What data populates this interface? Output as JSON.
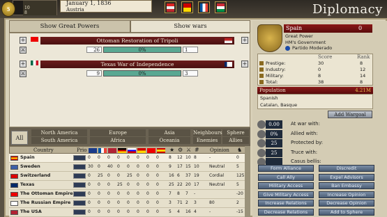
{
  "topbar": {
    "crest_badge": "5",
    "stats": [
      "",
      "10",
      "8"
    ],
    "date": "January 1, 1836",
    "country": "Austria"
  },
  "window": {
    "title": "Diplomacy"
  },
  "tabs": {
    "great_powers": "Show Great Powers",
    "wars": "Show wars"
  },
  "wars": [
    {
      "name": "Ottoman Restoration of Tripoli",
      "left_num": "26",
      "pct": "0%",
      "right_num": "1"
    },
    {
      "name": "Texas War of Independence",
      "left_num": "9",
      "pct": "0%",
      "right_num": "3"
    }
  ],
  "filters": {
    "all": "All",
    "regions": [
      "North America",
      "Europe",
      "Asia",
      "Neighbours",
      "Sphere",
      "South America",
      "Africa",
      "Oceania",
      "Enemies",
      "Allies"
    ]
  },
  "table": {
    "headers": {
      "country": "Country",
      "prio": "Prio",
      "opinion": "Opinion"
    },
    "rows": [
      {
        "name": "Spain",
        "cells": [
          "0",
          "0",
          "0",
          "0",
          "0",
          "0",
          "0",
          "0",
          "8",
          "12",
          "10",
          "8",
          "-",
          "",
          "0"
        ]
      },
      {
        "name": "Sweden",
        "cells": [
          "30",
          "0",
          "40",
          "0",
          "0",
          "0",
          "0",
          "0",
          "9",
          "17",
          "15",
          "10",
          "Neutral",
          "",
          "5"
        ]
      },
      {
        "name": "Switzerland",
        "cells": [
          "0",
          "25",
          "0",
          "0",
          "25",
          "0",
          "0",
          "0",
          "16",
          "6",
          "37",
          "19",
          "Cordial",
          "",
          "125"
        ]
      },
      {
        "name": "Texas",
        "cells": [
          "0",
          "0",
          "0",
          "25",
          "0",
          "0",
          "0",
          "0",
          "25",
          "22",
          "20",
          "17",
          "Neutral",
          "",
          "5"
        ]
      },
      {
        "name": "The Ottoman Empire",
        "cells": [
          "0",
          "0",
          "0",
          "0",
          "0",
          "0",
          "0",
          "0",
          "7",
          "8",
          "7",
          "-",
          "",
          "",
          "-20"
        ]
      },
      {
        "name": "The Russian Empire",
        "cells": [
          "0",
          "0",
          "0",
          "0",
          "0",
          "0",
          "0",
          "0",
          "3",
          "71",
          "2",
          "3",
          "80",
          "",
          "2"
        ]
      },
      {
        "name": "The USA",
        "cells": [
          "0",
          "0",
          "0",
          "0",
          "0",
          "0",
          "0",
          "0",
          "5",
          "4",
          "16",
          "4",
          "-",
          "",
          "-15"
        ]
      }
    ]
  },
  "selected_country": {
    "name": "Spain",
    "count": "0",
    "status": "Great Power",
    "government": "HM's Government",
    "party": "Partido Moderado",
    "score_header": "Score",
    "rank_header": "Rank",
    "scores": [
      {
        "label": "Prestige:",
        "score": "30",
        "rank": "8"
      },
      {
        "label": "Industry:",
        "score": "0",
        "rank": "12"
      },
      {
        "label": "Military:",
        "score": "8",
        "rank": "14"
      },
      {
        "label": "Total:",
        "score": "38",
        "rank": "8"
      }
    ],
    "population_label": "Population",
    "population_value": "4.21M",
    "cultures": "Spanish",
    "accepted": "Catalan, Basque",
    "add_wargoal": "Add Wargoal",
    "relations": [
      {
        "value": "0.00",
        "label": "At war with:"
      },
      {
        "value": "0%",
        "label": "Allied with:"
      },
      {
        "value": "25",
        "label": "Protected by:"
      },
      {
        "value": "25",
        "label": "Truce with:"
      },
      {
        "value": "",
        "label": "Casus bellis:"
      }
    ]
  },
  "actions": [
    [
      "Form Alliance",
      "Discredit"
    ],
    [
      "Call Ally",
      "Expel Advisors"
    ],
    [
      "Military Access",
      "Ban Embassy"
    ],
    [
      "Give Military Access",
      "Increase Opinion"
    ],
    [
      "Increase Relations",
      "Decrease Opinion"
    ],
    [
      "Decrease Relations",
      "Add to Sphere"
    ]
  ]
}
